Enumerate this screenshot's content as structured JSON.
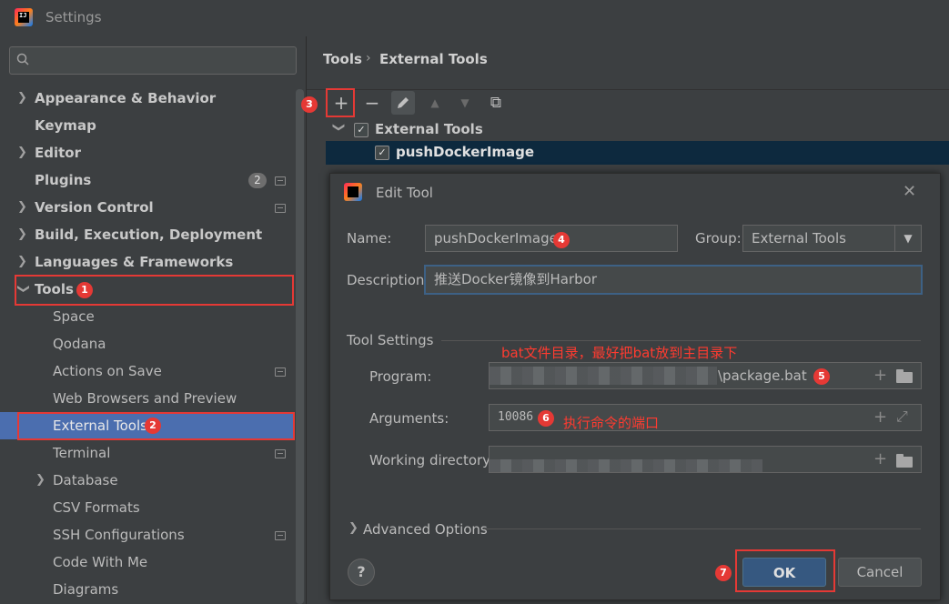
{
  "window": {
    "title": "Settings"
  },
  "sidebar": {
    "search": {
      "placeholder": ""
    },
    "items": [
      {
        "label": "Appearance & Behavior",
        "expandable": true
      },
      {
        "label": "Keymap"
      },
      {
        "label": "Editor",
        "expandable": true
      },
      {
        "label": "Plugins",
        "badge": "2"
      },
      {
        "label": "Version Control",
        "expandable": true
      },
      {
        "label": "Build, Execution, Deployment",
        "expandable": true
      },
      {
        "label": "Languages & Frameworks",
        "expandable": true
      },
      {
        "label": "Tools",
        "expanded": true
      },
      {
        "label": "Space"
      },
      {
        "label": "Qodana"
      },
      {
        "label": "Actions on Save"
      },
      {
        "label": "Web Browsers and Preview"
      },
      {
        "label": "External Tools",
        "selected": true
      },
      {
        "label": "Terminal"
      },
      {
        "label": "Database",
        "expandable": true
      },
      {
        "label": "CSV Formats"
      },
      {
        "label": "SSH Configurations"
      },
      {
        "label": "Code With Me"
      },
      {
        "label": "Diagrams"
      }
    ]
  },
  "breadcrumb": {
    "parent": "Tools",
    "separator": "›",
    "current": "External Tools"
  },
  "toolbar": {
    "add": "+",
    "remove": "−",
    "copy": "⧉"
  },
  "tree": {
    "group": "External Tools",
    "tool": "pushDockerImage"
  },
  "dialog": {
    "title": "Edit Tool",
    "name_label": "Name:",
    "name_value": "pushDockerImage",
    "group_label": "Group:",
    "group_value": "External Tools",
    "description_label": "Description:",
    "description_value": "推送Docker镜像到Harbor",
    "tool_settings_label": "Tool Settings",
    "program_label": "Program:",
    "program_value": "\\package.bat",
    "arguments_label": "Arguments:",
    "arguments_value": "10086",
    "working_dir_label": "Working directory:",
    "advanced_label": "Advanced Options",
    "help": "?",
    "ok": "OK",
    "cancel": "Cancel"
  },
  "annotations": {
    "program_note": "bat文件目录，最好把bat放到主目录下",
    "arguments_note": "执行命令的端口",
    "markers": [
      "1",
      "2",
      "3",
      "4",
      "5",
      "6",
      "7"
    ]
  },
  "colors": {
    "accent": "#4b6eaf",
    "annotation_red": "#e53935",
    "ok_button": "#365880"
  }
}
